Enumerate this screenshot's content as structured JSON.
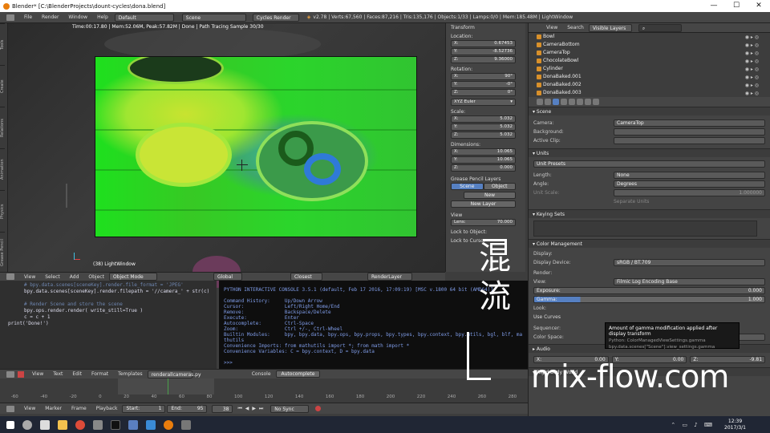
{
  "window": {
    "title": "Blender* [C:\\BlenderProjects\\dount-cycles\\dona.blend]",
    "min": "—",
    "max": "☐",
    "close": "✕"
  },
  "infobar": {
    "menus": [
      "File",
      "Render",
      "Window",
      "Help"
    ],
    "layout": "Default",
    "scene": "Scene",
    "engine": "Cycles Render",
    "stats": "v2.78 | Verts:67,560 | Faces:87,216 | Tris:135,176 | Objects:1/33 | Lamps:0/0 | Mem:185.48M | LightWindow"
  },
  "viewport": {
    "header_text": "Time:00:17.80 | Mem:52.06M, Peak:57.82M | Done | Path Tracing Sample 30/30",
    "object_label": "(38) LightWindow",
    "left_tabs": [
      "Tools",
      "Create",
      "Relations",
      "Animation",
      "Physics",
      "Grease Pencil"
    ]
  },
  "npanel": {
    "transform_title": "Transform",
    "location_label": "Location:",
    "location": [
      {
        "axis": "X:",
        "value": "0.67453"
      },
      {
        "axis": "Y:",
        "value": "-8.52736"
      },
      {
        "axis": "Z:",
        "value": "9.36000"
      }
    ],
    "rotation_label": "Rotation:",
    "rotation": [
      {
        "axis": "X:",
        "value": "90°"
      },
      {
        "axis": "Y:",
        "value": "-0°"
      },
      {
        "axis": "Z:",
        "value": "0°"
      }
    ],
    "rotation_mode": "XYZ Euler",
    "scale_label": "Scale:",
    "scale": [
      {
        "axis": "X:",
        "value": "5.032"
      },
      {
        "axis": "Y:",
        "value": "5.032"
      },
      {
        "axis": "Z:",
        "value": "5.032"
      }
    ],
    "dimensions_label": "Dimensions:",
    "dimensions": [
      {
        "axis": "X:",
        "value": "10.065"
      },
      {
        "axis": "Y:",
        "value": "10.065"
      },
      {
        "axis": "Z:",
        "value": "0.000"
      }
    ],
    "grease_title": "Grease Pencil Layers",
    "grease_tabs": [
      "Scene",
      "Object"
    ],
    "new_label": "New",
    "new_layer_label": "New Layer",
    "view_title": "View",
    "lens_label": "Lens:",
    "lens_value": "70.000",
    "lock_to_object": "Lock to Object:",
    "lock_to_cursor": "Lock to Cursor"
  },
  "outliner": {
    "menus": [
      "View",
      "Search"
    ],
    "filter": "Visible Layers",
    "items": [
      "Bowl",
      "CameraBottom",
      "CameraTop",
      "ChocolateBowl",
      "Cylinder",
      "DonaBaked.001",
      "DonaBaked.002",
      "DonaBaked.003"
    ]
  },
  "props": {
    "scene_title": "Scene",
    "camera_label": "Camera:",
    "camera_value": "CameraTop",
    "background_label": "Background:",
    "active_clip_label": "Active Clip:",
    "units_title": "Units",
    "unit_presets": "Unit Presets",
    "length_label": "Length:",
    "length_value": "None",
    "angle_label": "Angle:",
    "angle_value": "Degrees",
    "unit_scale_label": "Unit Scale:",
    "unit_scale_value": "1.000000",
    "separate_units": "Separate Units",
    "keying_title": "Keying Sets",
    "color_mgmt_title": "Color Management",
    "display_label": "Display:",
    "display_device_label": "Display Device:",
    "display_device_value": "sRGB / BT.709",
    "render_label": "Render:",
    "view_label": "View:",
    "view_value": "Filmic Log Encoding Base",
    "exposure_label": "Exposure:",
    "exposure_value": "0.000",
    "gamma_label": "Gamma:",
    "gamma_value": "1.000",
    "look_label": "Look:",
    "use_curves": "Use Curves",
    "sequencer_label": "Sequencer:",
    "color_space_label": "Color Space:",
    "color_space_value": "sRGB EOTF",
    "audio_title": "Audio",
    "gravity": [
      {
        "axis": "X:",
        "value": "0.00"
      },
      {
        "axis": "Y:",
        "value": "0.00"
      },
      {
        "axis": "Z:",
        "value": "-9.81"
      }
    ],
    "rigid_title": "Rigid Body World"
  },
  "tooltip": {
    "text": "Amount of gamma modification applied after display transform",
    "python1": "Python: ColorManagedViewSettings.gamma",
    "python2": "bpy.data.scenes[\"Scene\"].view_settings.gamma"
  },
  "viewbar": {
    "menus": [
      "View",
      "Select",
      "Add",
      "Object"
    ],
    "mode": "Object Mode",
    "pivot": "Global",
    "snap": "Closest",
    "layer": "RenderLayer"
  },
  "editor": {
    "lines": [
      "# bpy.data.scenes[sceneKey].render.file_format = 'JPEG'",
      "bpy.data.scenes[sceneKey].render.filepath = '//camera_' + str(c)",
      "",
      "# Render Scene and store the scene",
      "bpy.ops.render.render( write_still=True )",
      "c = c + 1",
      "print('Done!')"
    ]
  },
  "console": {
    "text": "PYTHON INTERACTIVE CONSOLE 3.5.1 (default, Feb 17 2016, 17:09:19) [MSC v.1800 64 bit (AMD64)]\n\nCommand History:     Up/Down Arrow\nCursor:              Left/Right Home/End\nRemove:              Backspace/Delete\nExecute:             Enter\nAutocomplete:        Ctrl-Space\nZoom:                Ctrl +/-, Ctrl-Wheel\nBuiltin Modules:     bpy, bpy.data, bpy.ops, bpy.props, bpy.types, bpy.context, bpy.utils, bgl, blf, ma\nthutils\nConvenience Imports: from mathutils import *; from math import *\nConvenience Variables: C = bpy.context, D = bpy.data\n\n>>> "
  },
  "editor_bar": {
    "menus": [
      "View",
      "Text",
      "Edit",
      "Format",
      "Templates"
    ],
    "file": "renderallcameras.py",
    "console_menus": [
      "Console",
      "Autocomplete"
    ]
  },
  "timeline": {
    "ticks": [
      "-60",
      "-40",
      "-20",
      "0",
      "20",
      "40",
      "60",
      "80",
      "100",
      "120",
      "140",
      "160",
      "180",
      "200",
      "220",
      "240",
      "260",
      "280"
    ],
    "menus": [
      "View",
      "Marker",
      "Frame",
      "Playback"
    ],
    "start": "Start:",
    "start_value": "1",
    "end": "End:",
    "end_value": "95",
    "frame": "38",
    "sync": "No Sync"
  },
  "taskbar": {
    "time": "12:39",
    "date": "2017/3/1"
  },
  "watermark": {
    "kanji1": "混",
    "kanji2": "流",
    "site": "mix-flow.com"
  }
}
